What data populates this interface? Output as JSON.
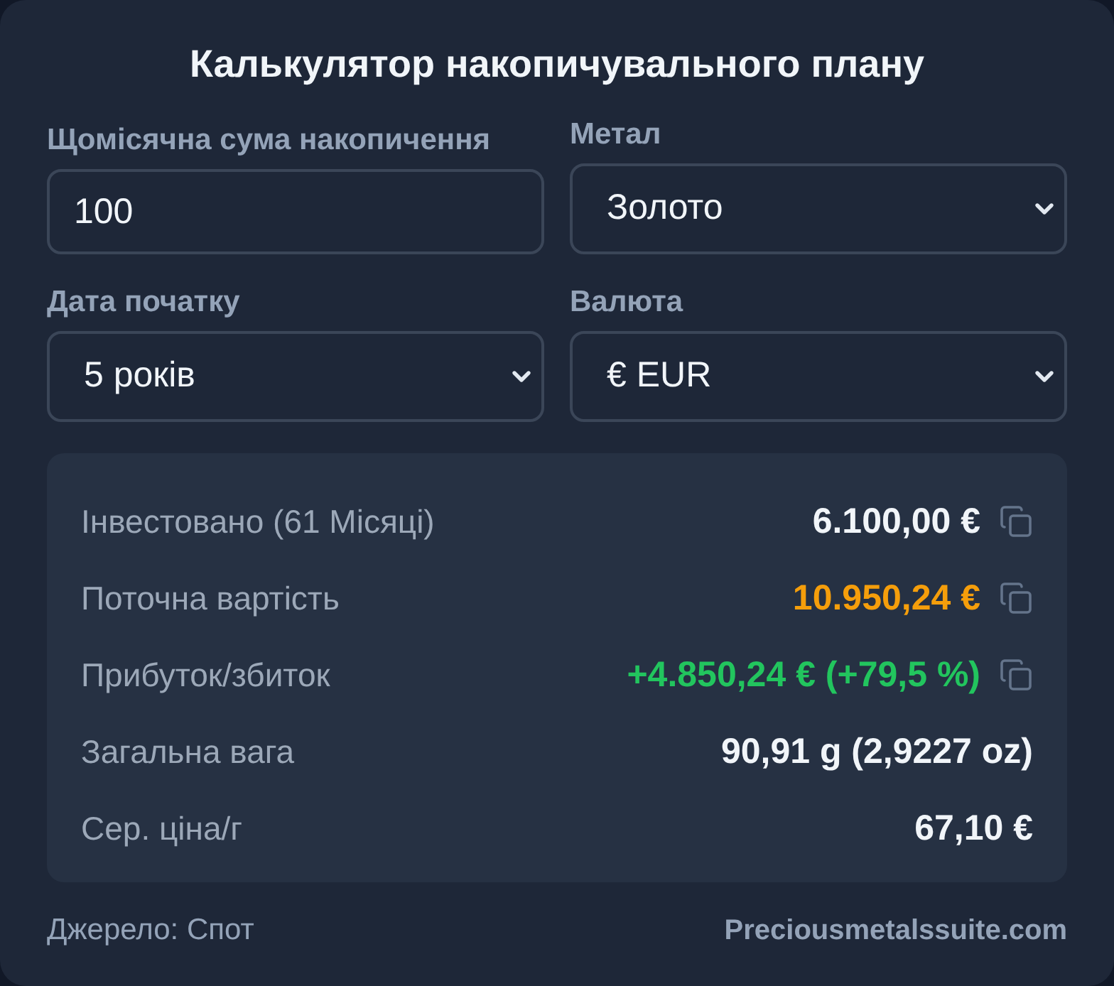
{
  "title": "Калькулятор накопичувального плану",
  "fields": [
    {
      "kind": "input",
      "label": "Щомісячна сума накопичення",
      "value": "100"
    },
    {
      "kind": "select",
      "label": "Метал",
      "value": "Золото"
    },
    {
      "kind": "select",
      "label": "Дата початку",
      "value": "5 років"
    },
    {
      "kind": "select",
      "label": "Валюта",
      "value": "€ EUR"
    }
  ],
  "results": [
    {
      "label": "Інвестовано (61 Місяці)",
      "value": "6.100,00 €",
      "kind": "neutral",
      "copyable": true
    },
    {
      "label": "Поточна вартість",
      "value": "10.950,24 €",
      "kind": "highlight",
      "copyable": true
    },
    {
      "label": "Прибуток/збиток",
      "value": "+4.850,24 € (+79,5 %)",
      "kind": "gain",
      "copyable": true
    },
    {
      "label": "Загальна вага",
      "value": "90,91 g (2,9227 oz)",
      "kind": "neutral",
      "copyable": false
    },
    {
      "label": "Сер. ціна/г",
      "value": "67,10 €",
      "kind": "neutral",
      "copyable": false
    }
  ],
  "footer": {
    "source": "Джерело: Спот",
    "site": "Preciousmetalssuite.com"
  }
}
